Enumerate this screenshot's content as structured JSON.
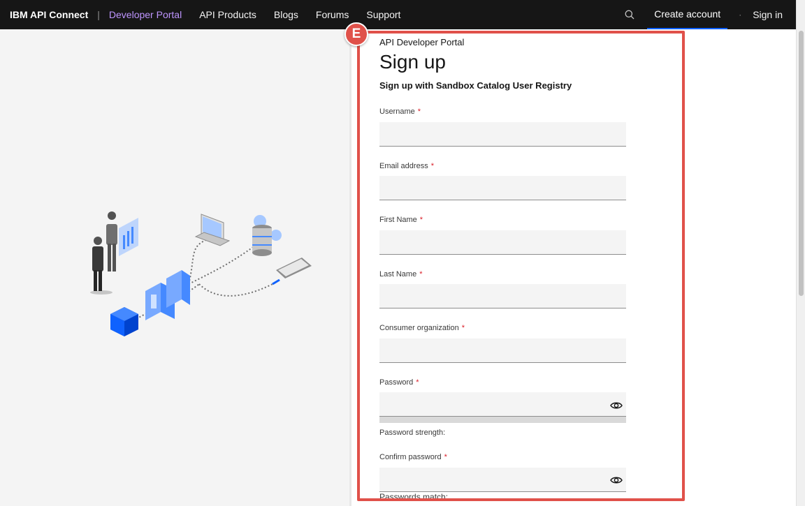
{
  "nav": {
    "brand": "IBM API Connect",
    "separator": "|",
    "links": [
      "Developer Portal",
      "API Products",
      "Blogs",
      "Forums",
      "Support"
    ],
    "active_index": 0,
    "create_account": "Create account",
    "dot": "·",
    "sign_in": "Sign in",
    "search_icon": "search-icon"
  },
  "form": {
    "eyebrow": "API Developer Portal",
    "title": "Sign up",
    "subtitle": "Sign up with Sandbox Catalog User Registry",
    "required_mark": "*",
    "fields": [
      {
        "label": "Username",
        "value": ""
      },
      {
        "label": "Email address",
        "value": ""
      },
      {
        "label": "First Name",
        "value": ""
      },
      {
        "label": "Last Name",
        "value": ""
      },
      {
        "label": "Consumer organization",
        "value": ""
      },
      {
        "label": "Password",
        "value": ""
      },
      {
        "label": "Confirm password",
        "value": ""
      }
    ],
    "password_strength": "Password strength:",
    "passwords_match": "Passwords match:"
  },
  "annotation": {
    "marker": "E",
    "color": "#e0514a"
  },
  "colors": {
    "nav_bg": "#161616",
    "nav_active": "#be95ff",
    "accent": "#0f62fe",
    "required": "#da1e28"
  }
}
